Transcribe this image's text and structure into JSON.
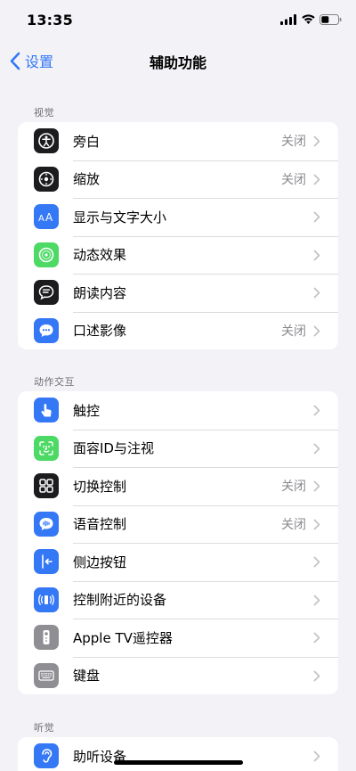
{
  "status_bar": {
    "time": "13:35"
  },
  "nav": {
    "back_label": "设置",
    "title": "辅助功能"
  },
  "sections": [
    {
      "header": "视觉",
      "items": [
        {
          "label": "旁白",
          "value": "关闭",
          "icon": "voiceover-icon",
          "icon_color": "#1c1c1e"
        },
        {
          "label": "缩放",
          "value": "关闭",
          "icon": "zoom-icon",
          "icon_color": "#1c1c1e"
        },
        {
          "label": "显示与文字大小",
          "value": "",
          "icon": "text-size-icon",
          "icon_color": "#3478f6"
        },
        {
          "label": "动态效果",
          "value": "",
          "icon": "motion-icon",
          "icon_color": "#4cd964"
        },
        {
          "label": "朗读内容",
          "value": "",
          "icon": "spoken-content-icon",
          "icon_color": "#1c1c1e"
        },
        {
          "label": "口述影像",
          "value": "关闭",
          "icon": "audio-description-icon",
          "icon_color": "#3478f6"
        }
      ]
    },
    {
      "header": "动作交互",
      "items": [
        {
          "label": "触控",
          "value": "",
          "icon": "touch-icon",
          "icon_color": "#3478f6"
        },
        {
          "label": "面容ID与注视",
          "value": "",
          "icon": "face-id-icon",
          "icon_color": "#4cd964"
        },
        {
          "label": "切换控制",
          "value": "关闭",
          "icon": "switch-control-icon",
          "icon_color": "#1c1c1e"
        },
        {
          "label": "语音控制",
          "value": "关闭",
          "icon": "voice-control-icon",
          "icon_color": "#3478f6"
        },
        {
          "label": "侧边按钮",
          "value": "",
          "icon": "side-button-icon",
          "icon_color": "#3478f6"
        },
        {
          "label": "控制附近的设备",
          "value": "",
          "icon": "nearby-devices-icon",
          "icon_color": "#3478f6"
        },
        {
          "label": "Apple TV遥控器",
          "value": "",
          "icon": "tv-remote-icon",
          "icon_color": "#8e8e93"
        },
        {
          "label": "键盘",
          "value": "",
          "icon": "keyboard-icon",
          "icon_color": "#8e8e93"
        }
      ]
    },
    {
      "header": "听觉",
      "items": [
        {
          "label": "助听设备",
          "value": "",
          "icon": "hearing-devices-icon",
          "icon_color": "#3478f6"
        }
      ]
    }
  ]
}
